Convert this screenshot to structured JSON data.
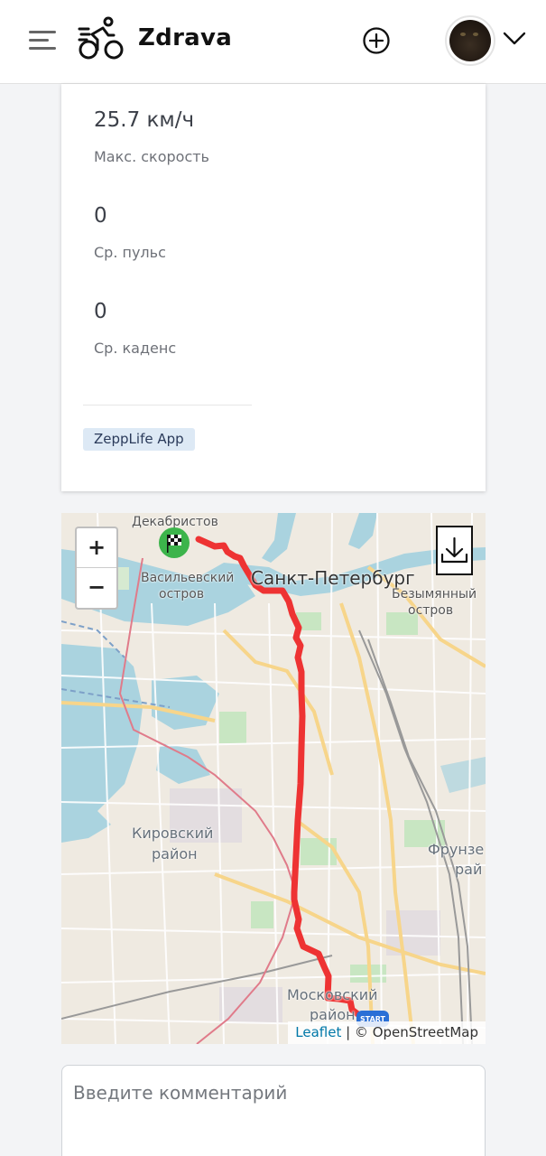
{
  "header": {
    "brand": "Zdrava",
    "menu_icon": "hamburger-menu-icon",
    "logo_icon": "cyclist-logo-icon",
    "add_icon": "plus-circle-icon",
    "dropdown_icon": "chevron-down-icon"
  },
  "stats": [
    {
      "value": "25.7 км/ч",
      "label": "Макс. скорость"
    },
    {
      "value": "0",
      "label": "Ср. пульс"
    },
    {
      "value": "0",
      "label": "Ср. каденс"
    }
  ],
  "source_badge": "ZeppLife App",
  "map": {
    "zoom_in": "+",
    "zoom_out": "−",
    "download_icon": "download-icon",
    "finish_icon": "checkered-flag-icon",
    "start_icon": "start-marker-icon",
    "labels": {
      "dekabristov": "Декабристов",
      "vasileostrovsky_1": "Васильевский",
      "vasileostrovsky_2": "остров",
      "city": "Санкт-Петербург",
      "bezymyanny_1": "Безымянный",
      "bezymyanny_2": "остров",
      "kirovsky_1": "Кировский",
      "kirovsky_2": "район",
      "frunzensky_1": "Фрунзе",
      "frunzensky_2": "рай",
      "moskovsky_1": "Московский",
      "moskovsky_2": "район"
    },
    "attribution_link": "Leaflet",
    "attribution_text": " | © OpenStreetMap",
    "route_color": "#ee3333"
  },
  "comment": {
    "placeholder": "Введите комментарий"
  }
}
